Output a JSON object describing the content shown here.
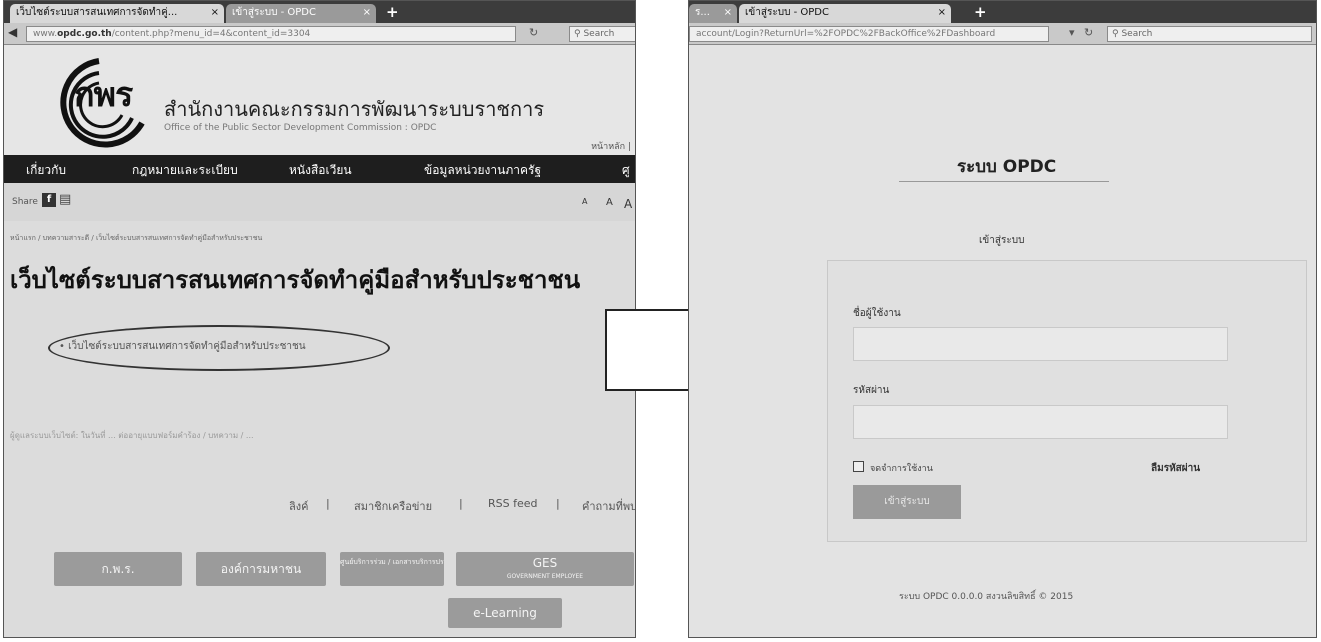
{
  "left": {
    "tabs": [
      {
        "label": "เว็บไซต์ระบบสารสนเทศการจัดทำคู่...",
        "close": "×"
      },
      {
        "label": "เข้าสู่ระบบ - OPDC",
        "close": "×"
      }
    ],
    "new_tab": "+",
    "url": {
      "prefix": "www.",
      "domain": "opdc.go.th",
      "rest": "/content.php?menu_id=4&content_id=3304"
    },
    "search_placeholder": "Search",
    "logo": "กพร",
    "org_name_th": "สำนักงานคณะกรรมการพัฒนาระบบราชการ",
    "org_name_en": "Office of the Public Sector Development Commission : OPDC",
    "header_util": "หน้าหลัก |",
    "nav": [
      "เกี่ยวกับ",
      "กฎหมายและระเบียบ",
      "หนังสือเวียน",
      "ข้อมูลหน่วยงานภาครัฐ",
      "ศู"
    ],
    "share_label": "Share",
    "font_sizes": [
      "A",
      "A",
      "A"
    ],
    "breadcrumb": "หน้าแรก / บทความสาระดี / เว็บไซต์ระบบสารสนเทศการจัดทำคู่มือสำหรับประชาชน",
    "page_title": "เว็บไซต์ระบบสารสนเทศการจัดทำคู่มือสำหรับประชาชน",
    "bullet": "• เว็บไซต์ระบบสารสนเทศการจัดทำคู่มือสำหรับประชาชน",
    "update_note": "ผู้ดูแลระบบเว็บไซต์: ในวันที่ ... ต่ออายุแบบฟอร์มคำร้อง / บทความ / ...",
    "footer_links": [
      "ลิงค์",
      "|",
      "สมาชิกเครือข่าย",
      "|",
      "RSS feed",
      "|",
      "คำถามที่พบ"
    ],
    "footer_buttons": [
      {
        "label": "ก.พ.ร."
      },
      {
        "label": "องค์การมหาชน"
      },
      {
        "label": "ศูนย์บริการร่วม / เอกสารบริการประชาชน"
      },
      {
        "label": "GES",
        "sub": "GOVERNMENT EMPLOYEE"
      },
      {
        "label": "e-Learning"
      }
    ]
  },
  "right": {
    "tabs": [
      {
        "label": "ร...",
        "close": "×"
      },
      {
        "label": "เข้าสู่ระบบ - OPDC",
        "close": "×"
      }
    ],
    "new_tab": "+",
    "url": "account/Login?ReturnUrl=%2FOPDC%2FBackOffice%2FDashboard",
    "search_placeholder": "Search",
    "system_name": "ระบบ OPDC",
    "login_heading": "เข้าสู่ระบบ",
    "username_label": "ชื่อผู้ใช้งาน",
    "password_label": "รหัสผ่าน",
    "remember_label": "จดจำการใช้งาน",
    "forgot_label": "ลืมรหัสผ่าน",
    "login_button": "เข้าสู่ระบบ",
    "copyright": "ระบบ OPDC 0.0.0.0 สงวนลิขสิทธิ์ © 2015"
  }
}
